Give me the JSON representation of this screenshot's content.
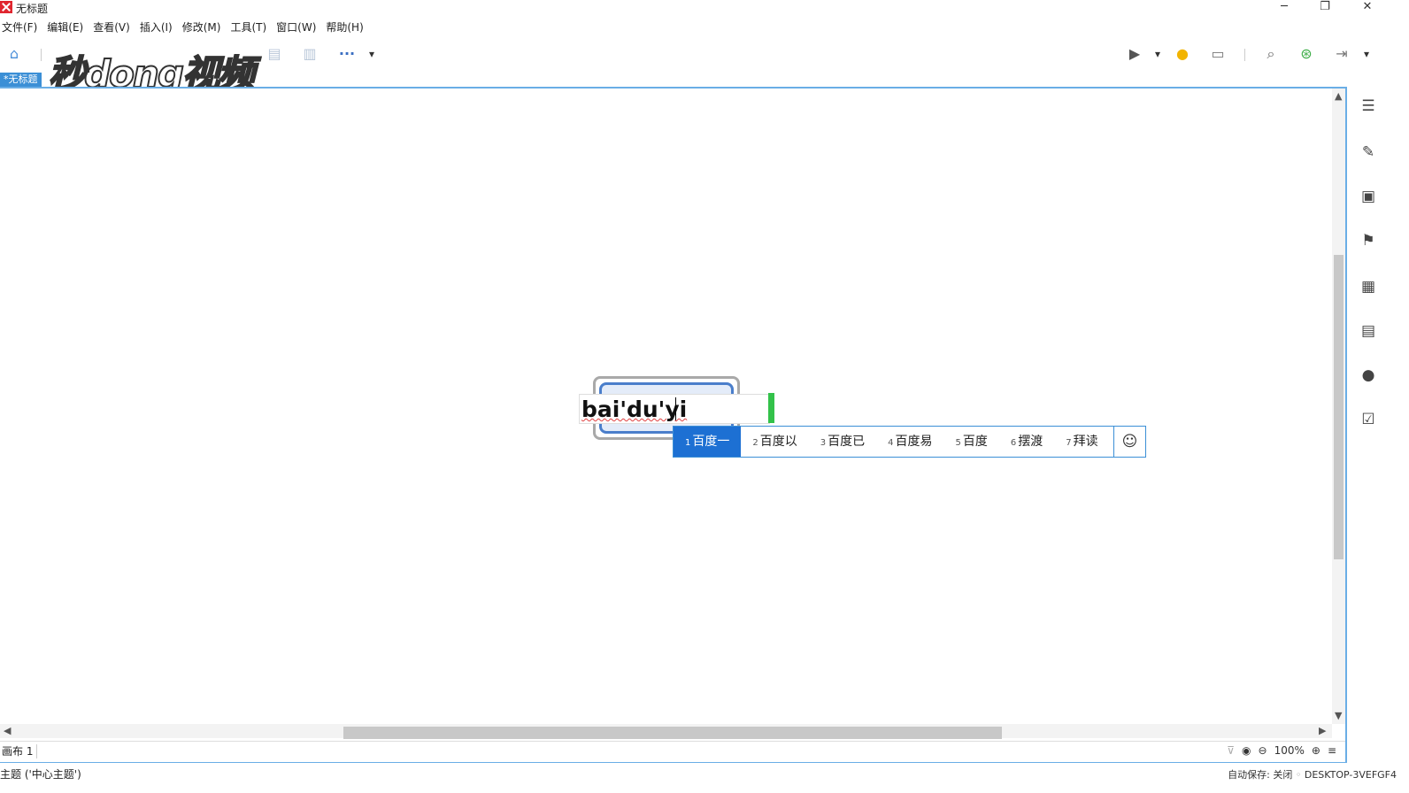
{
  "window": {
    "title": "无标题",
    "minimize": "─",
    "restore": "❐",
    "close": "✕"
  },
  "menu": [
    "文件(F)",
    "编辑(E)",
    "查看(V)",
    "插入(I)",
    "修改(M)",
    "工具(T)",
    "窗口(W)",
    "帮助(H)"
  ],
  "toolbar": {
    "more": "···",
    "dropdown": "▾"
  },
  "watermark": "秒dong视频",
  "document_tab": "*无标题",
  "editor": {
    "text": "bai'du'yi"
  },
  "ime": {
    "candidates": [
      {
        "num": "1",
        "text": "百度一"
      },
      {
        "num": "2",
        "text": "百度以"
      },
      {
        "num": "3",
        "text": "百度已"
      },
      {
        "num": "4",
        "text": "百度易"
      },
      {
        "num": "5",
        "text": "百度"
      },
      {
        "num": "6",
        "text": "摆渡"
      },
      {
        "num": "7",
        "text": "拜读"
      }
    ],
    "selected_index": 0,
    "emoji": "☺"
  },
  "bottombar": {
    "sheet": "画布 1",
    "zoom": "100%",
    "zoom_out": "⊖",
    "zoom_in": "⊕"
  },
  "status": {
    "left": "主题 ('中心主题')",
    "autosave": "自动保存: 关闭",
    "computer": "DESKTOP-3VEFGF4"
  },
  "colors": {
    "accent": "#3b8fd6",
    "ime_selected": "#1d70d3",
    "topic_border": "#4a7ecb",
    "topic_fill": "#e4ecf9",
    "handle": "#33c24a"
  }
}
